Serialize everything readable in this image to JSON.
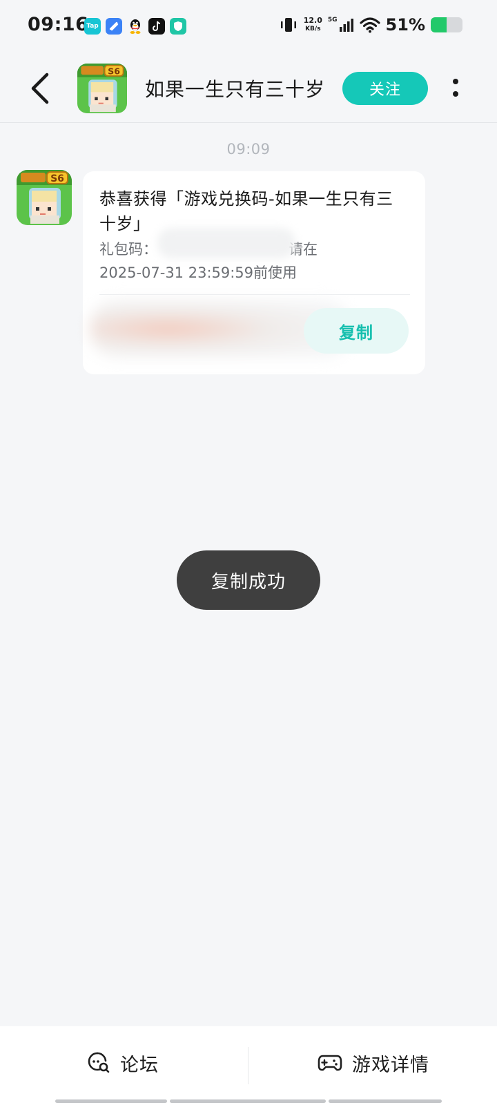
{
  "status_bar": {
    "time": "09:16",
    "apps": [
      "Tap",
      "",
      "",
      "",
      ""
    ],
    "net_speed_value": "12.0",
    "net_speed_unit": "KB/s",
    "network": "5G",
    "battery_text": "51%",
    "battery_level": 0.51
  },
  "header": {
    "title": "如果一生只有三十岁",
    "follow_label": "关注",
    "avatar_badge": "S6"
  },
  "chat": {
    "timestamp": "09:09",
    "message": {
      "title": "恭喜获得「游戏兑换码-如果一生只有三十岁」",
      "code_label": "礼包码：",
      "code_suffix": "请在",
      "expiry": "2025-07-31 23:59:59前使用",
      "copy_label": "复制"
    }
  },
  "toast": "复制成功",
  "bottom_bar": {
    "forum_label": "论坛",
    "details_label": "游戏详情"
  },
  "colors": {
    "accent": "#15c8b8",
    "background": "#f5f6f8",
    "toast": "#3f3f3f"
  }
}
